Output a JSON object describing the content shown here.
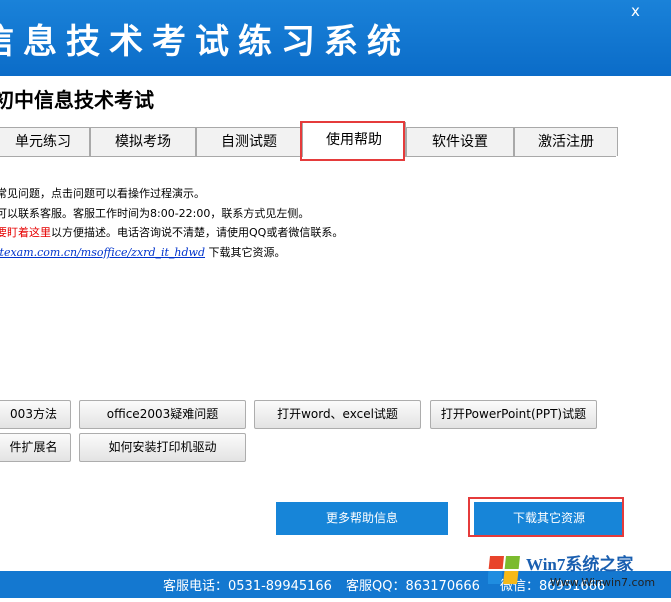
{
  "header": {
    "title": "信息技术考试练习系统",
    "close": "x"
  },
  "subtitle": "初中信息技术考试",
  "tabs": [
    "单元练习",
    "模拟考场",
    "自测试题",
    "使用帮助",
    "软件设置",
    "激活注册"
  ],
  "help": {
    "line1": "常见问题，点击问题可以看操作过程演示。",
    "line2": "可以联系客服。客服工作时间为8:00-22:00，联系方式见左侧。",
    "line3_red": "要盯着这里",
    "line3_rest": "以方便描述。电话咨询说不清楚，请使用QQ或者微信联系。",
    "link": "itexam.com.cn/msoffice/zxrd_it_hdwd",
    "link_suffix": " 下载其它资源。"
  },
  "faq_buttons": {
    "b1": "003方法",
    "b2": "office2003疑难问题",
    "b3": "打开word、excel试题",
    "b4": "打开PowerPoint(PPT)试题",
    "b5": "件扩展名",
    "b6": "如何安装打印机驱动"
  },
  "actions": {
    "more": "更多帮助信息",
    "download": "下载其它资源"
  },
  "footer": {
    "phone": "客服电话：0531-89945166",
    "qq": "客服QQ：863170666",
    "wechat": "微信：86951666"
  },
  "watermark": {
    "brand": "Win7系统之家",
    "url": "Www.Winwin7.com"
  }
}
